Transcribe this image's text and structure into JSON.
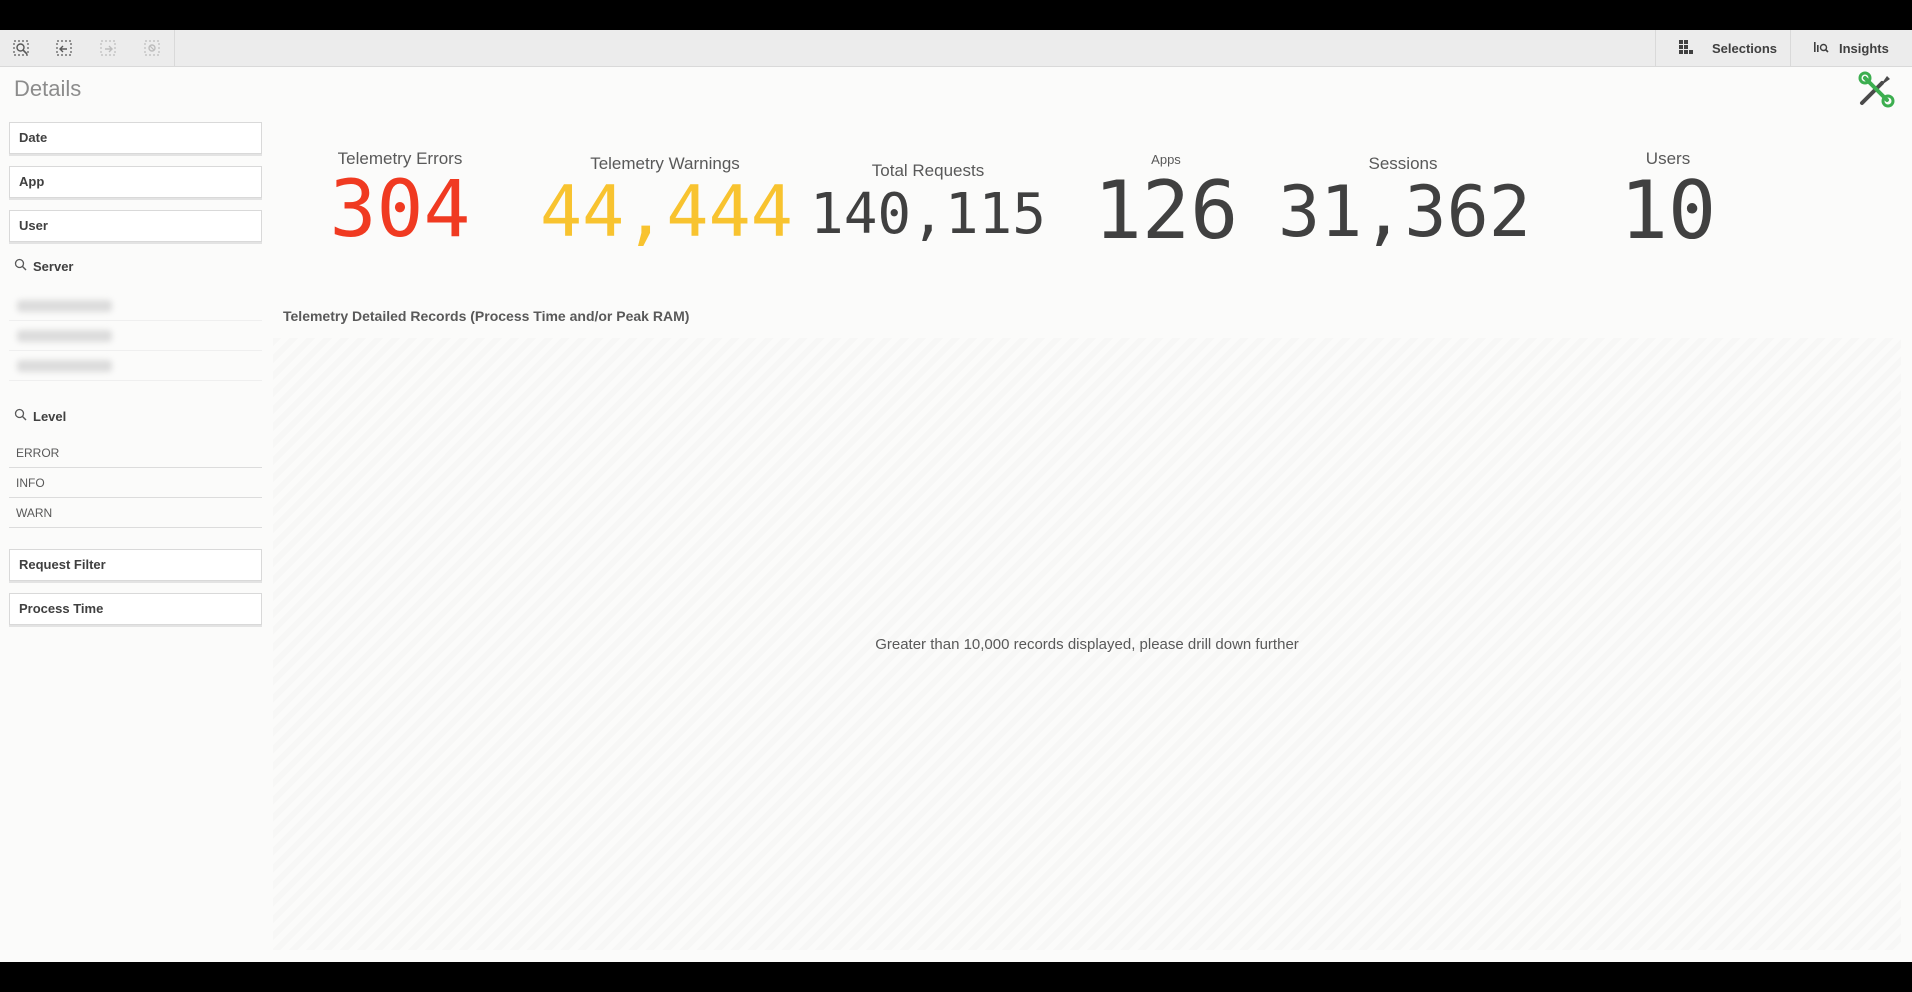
{
  "toolbar": {
    "icons": [
      "smart-search-icon",
      "step-back-icon",
      "step-forward-icon",
      "clear-selections-icon"
    ],
    "selections_label": "Selections",
    "insights_label": "Insights"
  },
  "sheet": {
    "title": "Details"
  },
  "filters": {
    "date": "Date",
    "app": "App",
    "user": "User",
    "server": {
      "label": "Server"
    },
    "level": {
      "label": "Level",
      "values": [
        "ERROR",
        "INFO",
        "WARN"
      ]
    },
    "request_filter": "Request Filter",
    "process_time": "Process Time"
  },
  "kpis": [
    {
      "label": "Telemetry Errors",
      "value": "304",
      "color": "#f03a21"
    },
    {
      "label": "Telemetry Warnings",
      "value": "44,444",
      "color": "#f8c32f"
    },
    {
      "label": "Total Requests",
      "value": "140,115",
      "color": "#404040"
    },
    {
      "label": "Apps",
      "value": "126",
      "color": "#404040"
    },
    {
      "label": "Sessions",
      "value": "31,362",
      "color": "#404040"
    },
    {
      "label": "Users",
      "value": "10",
      "color": "#404040"
    }
  ],
  "table": {
    "title": "Telemetry Detailed Records (Process Time and/or Peak RAM)",
    "message": "Greater than 10,000 records displayed, please drill down further"
  }
}
